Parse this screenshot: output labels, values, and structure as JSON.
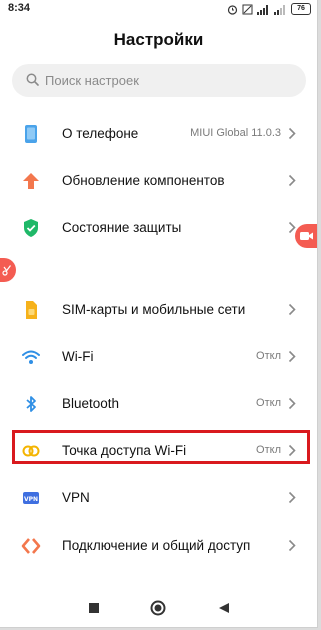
{
  "status_bar": {
    "time": "8:34",
    "battery": "76"
  },
  "title": "Настройки",
  "search": {
    "placeholder": "Поиск настроек"
  },
  "items": [
    {
      "label": "О телефоне",
      "value": "MIUI Global 11.0.3",
      "icon": "phone-icon"
    },
    {
      "label": "Обновление компонентов",
      "value": "",
      "icon": "update-arrow-icon"
    },
    {
      "label": "Состояние защиты",
      "value": "",
      "icon": "shield-check-icon"
    },
    {
      "label": "SIM-карты и мобильные сети",
      "value": "",
      "icon": "sim-card-icon"
    },
    {
      "label": "Wi-Fi",
      "value": "Откл",
      "icon": "wifi-icon"
    },
    {
      "label": "Bluetooth",
      "value": "Откл",
      "icon": "bluetooth-icon"
    },
    {
      "label": "Точка доступа Wi-Fi",
      "value": "Откл",
      "icon": "hotspot-icon"
    },
    {
      "label": "VPN",
      "value": "",
      "icon": "vpn-icon"
    },
    {
      "label": "Подключение и общий доступ",
      "value": "",
      "icon": "connection-sharing-icon"
    }
  ],
  "nav": [
    "square-icon",
    "circle-icon",
    "triangle-back-icon"
  ],
  "colors": {
    "highlight": "#d9191e",
    "accent_orange": "#f3774d",
    "green": "#1fb868",
    "blue": "#2f8fe5"
  }
}
